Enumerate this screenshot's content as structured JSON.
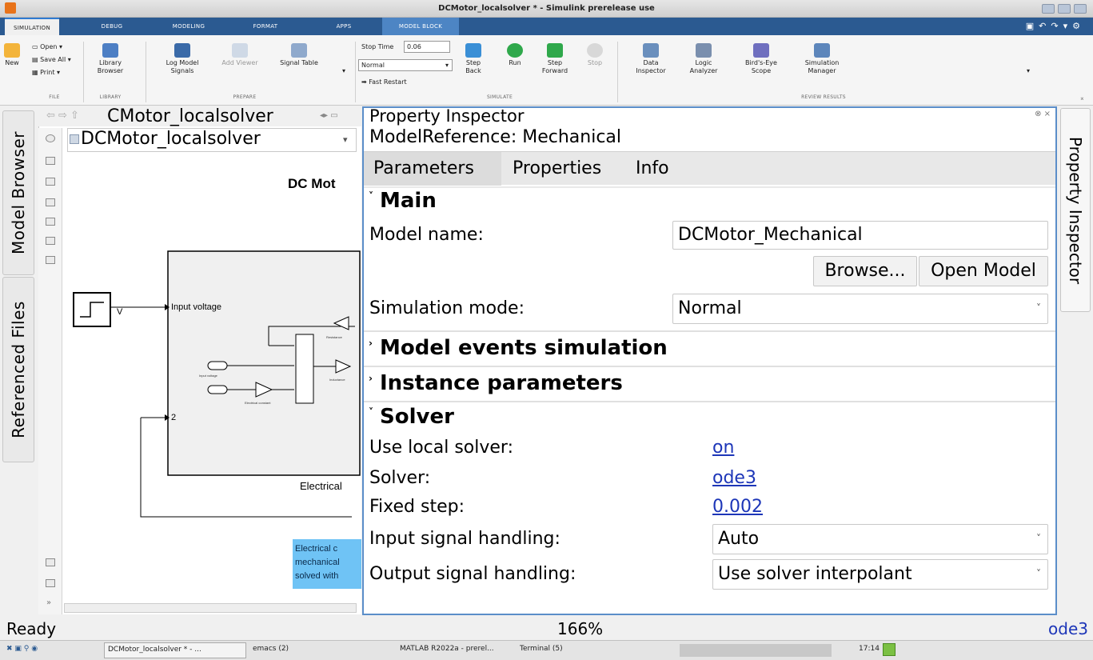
{
  "window": {
    "title": "DCMotor_localsolver * - Simulink prerelease use"
  },
  "tabs": [
    "SIMULATION",
    "DEBUG",
    "MODELING",
    "FORMAT",
    "APPS",
    "MODEL BLOCK"
  ],
  "ribbon": {
    "file": {
      "new": "New",
      "open": "Open",
      "save_all": "Save All",
      "print": "Print",
      "section": "FILE"
    },
    "library": {
      "browser": "Library Browser",
      "section": "LIBRARY"
    },
    "prepare": {
      "log_signals": "Log Model Signals",
      "add_viewer": "Add Viewer",
      "signal_table": "Signal Table",
      "section": "PREPARE"
    },
    "simulate": {
      "stop_time_label": "Stop Time",
      "stop_time_value": "0.06",
      "mode": "Normal",
      "fast_restart": "Fast Restart",
      "step_back": "Step Back",
      "run": "Run",
      "step_forward": "Step Forward",
      "stop": "Stop",
      "section": "SIMULATE"
    },
    "review": {
      "data_inspector": "Data Inspector",
      "logic_analyzer": "Logic Analyzer",
      "birds_eye": "Bird's-Eye Scope",
      "sim_manager": "Simulation Manager",
      "section": "REVIEW RESULTS"
    }
  },
  "left_tabs": {
    "model_browser": "Model Browser",
    "referenced_files": "Referenced Files"
  },
  "canvas": {
    "tab_title": "CMotor_localsolver",
    "breadcrumb": "DCMotor_localsolver",
    "title": "DC Mot",
    "input_label": "Input voltage",
    "v_label": "V",
    "port2": "2",
    "block_name": "Electrical",
    "note": [
      "Electrical c",
      "mechanical",
      "solved with"
    ],
    "tiny": {
      "input_voltage": "Input voltage",
      "electrical_constant": "Electrical constant",
      "resistance": "Resistance",
      "inductance": "Inductance"
    }
  },
  "inspector": {
    "title": "Property Inspector",
    "subtitle": "ModelReference: Mechanical",
    "tabs": [
      "Parameters",
      "Properties",
      "Info"
    ],
    "main": {
      "header": "Main",
      "model_name_label": "Model name:",
      "model_name_value": "DCMotor_Mechanical",
      "browse": "Browse...",
      "open_model": "Open Model",
      "sim_mode_label": "Simulation mode:",
      "sim_mode_value": "Normal"
    },
    "events_header": "Model events simulation",
    "instance_header": "Instance parameters",
    "solver": {
      "header": "Solver",
      "use_local_label": "Use local solver:",
      "use_local_value": "on",
      "solver_label": "Solver:",
      "solver_value": "ode3",
      "fixed_step_label": "Fixed step:",
      "fixed_step_value": "0.002",
      "input_handling_label": "Input signal handling:",
      "input_handling_value": "Auto",
      "output_handling_label": "Output signal handling:",
      "output_handling_value": "Use solver interpolant"
    }
  },
  "right_tab": "Property Inspector",
  "status": {
    "state": "Ready",
    "zoom": "166%",
    "solver": "ode3"
  },
  "taskbar": {
    "app1": "DCMotor_localsolver * - ...",
    "app2": "emacs (2)",
    "app3": "MATLAB R2022a - prerel...",
    "app4": "Terminal (5)",
    "clock": "17:14"
  },
  "colors": {
    "accent": "#2b5a91",
    "link": "#1d36b8",
    "inspector_border": "#5b8ec9",
    "note_bg": "#6fc3f5"
  }
}
